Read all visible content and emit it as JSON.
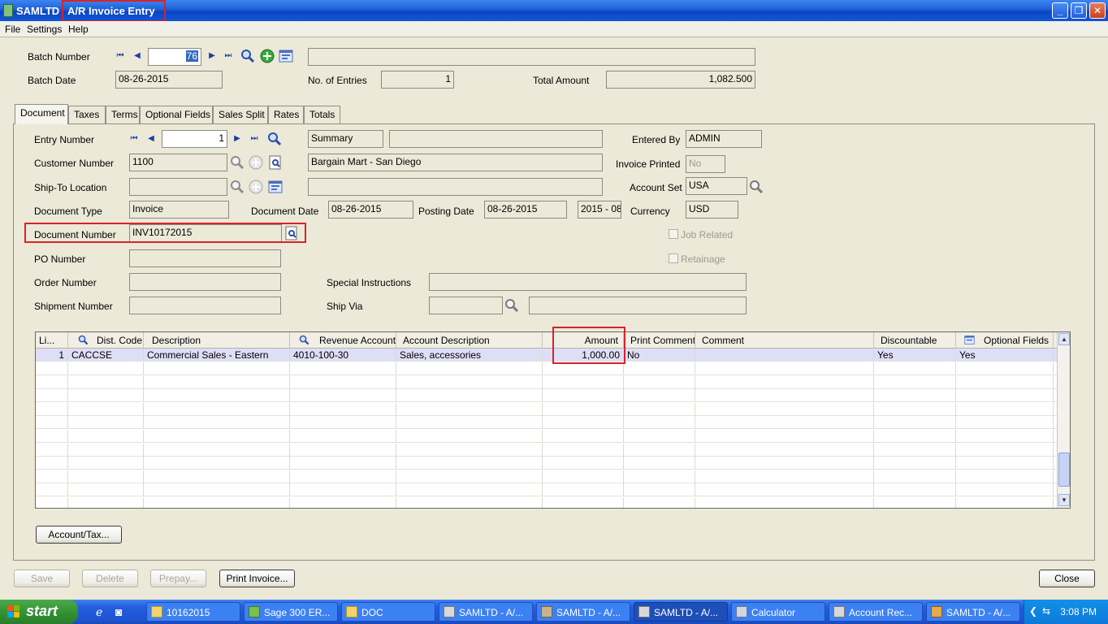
{
  "window": {
    "app": "SAMLTD",
    "title": "A/R Invoice Entry"
  },
  "menu": [
    "File",
    "Settings",
    "Help"
  ],
  "batch": {
    "number_label": "Batch Number",
    "number": "76",
    "description": "",
    "date_label": "Batch Date",
    "date": "08-26-2015",
    "entries_label": "No. of Entries",
    "entries": "1",
    "total_label": "Total Amount",
    "total": "1,082.500"
  },
  "tabs": [
    "Document",
    "Taxes",
    "Terms",
    "Optional Fields",
    "Sales Split",
    "Rates",
    "Totals"
  ],
  "doc": {
    "entry_label": "Entry Number",
    "entry": "1",
    "entry_type": "Summary",
    "entry_desc": "",
    "entered_by_label": "Entered By",
    "entered_by": "ADMIN",
    "customer_label": "Customer Number",
    "customer": "1100",
    "customer_name": "Bargain Mart - San Diego",
    "printed_label": "Invoice Printed",
    "printed": "No",
    "shipto_label": "Ship-To Location",
    "shipto": "",
    "shipto_desc": "",
    "acctset_label": "Account Set",
    "acctset": "USA",
    "doctype_label": "Document Type",
    "doctype": "Invoice",
    "docdate_label": "Document Date",
    "docdate": "08-26-2015",
    "postdate_label": "Posting Date",
    "postdate": "08-26-2015",
    "period": "2015 - 08",
    "currency_label": "Currency",
    "currency": "USD",
    "docnum_label": "Document Number",
    "docnum": "INV10172015",
    "job_label": "Job Related",
    "retainage_label": "Retainage",
    "po_label": "PO Number",
    "po": "",
    "order_label": "Order Number",
    "order": "",
    "shipment_label": "Shipment Number",
    "shipment": "",
    "special_label": "Special Instructions",
    "special": "",
    "shipvia_label": "Ship Via",
    "shipvia": "",
    "shipvia_desc": ""
  },
  "grid": {
    "headers": [
      "Li...",
      "Dist. Code",
      "Description",
      "Revenue Account",
      "Account Description",
      "Amount",
      "Print Comment",
      "Comment",
      "Discountable",
      "Optional Fields"
    ],
    "rows": [
      [
        "1",
        "CACCSE",
        "Commercial Sales - Eastern",
        "4010-100-30",
        "Sales, accessories",
        "1,000.00",
        "No",
        "",
        "Yes",
        "Yes"
      ]
    ]
  },
  "buttons": {
    "account_tax": "Account/Tax...",
    "save": "Save",
    "delete": "Delete",
    "prepay": "Prepay...",
    "print": "Print Invoice...",
    "close": "Close"
  },
  "taskbar": {
    "start": "start",
    "items": [
      "10162015",
      "Sage 300 ER...",
      "DOC",
      "SAMLTD - A/...",
      "SAMLTD - A/...",
      "SAMLTD - A/...",
      "Calculator",
      "Account Rec...",
      "SAMLTD - A/..."
    ],
    "clock": "3:08 PM"
  },
  "colors": {
    "highlight": "#d8232a",
    "titlebar": "#0a46c2"
  }
}
